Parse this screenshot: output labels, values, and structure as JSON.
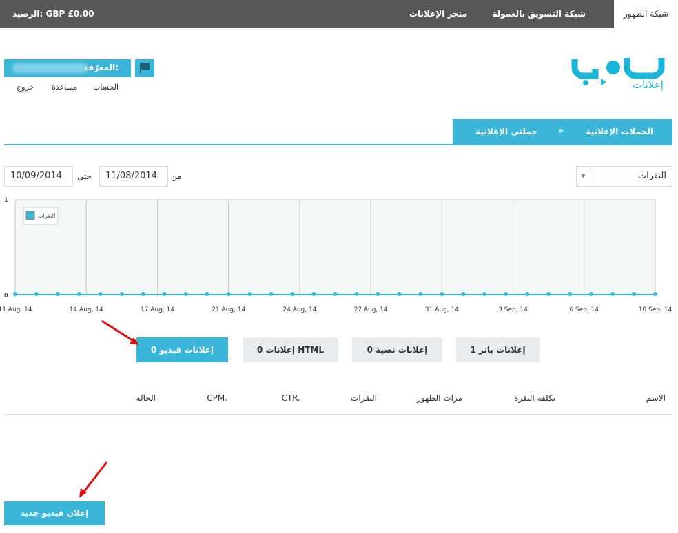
{
  "topbar": {
    "tabs": [
      "شبكة الظهور",
      "شبكة التسويق بالعمولة",
      "متجر الإعلانات"
    ],
    "balance": "الرصيد: GBP £0.00"
  },
  "logo": {
    "sub": "إعلانات"
  },
  "user": {
    "id_label": "المعرّف:",
    "links": [
      "الحساب",
      "مساعدة",
      "خروج"
    ]
  },
  "breadcrumb": {
    "items": [
      "الحملات الإعلانية",
      "حملتي الإعلانية"
    ],
    "sep": "»"
  },
  "filters": {
    "metric": "النقرات",
    "from_label": "من",
    "from": "11/08/2014",
    "to_label": "حتى",
    "to": "10/09/2014"
  },
  "chart_data": {
    "type": "line",
    "legend": "النقرات",
    "ylim": [
      0,
      1
    ],
    "yticks": [
      "0",
      "1"
    ],
    "xticks": [
      "11 Aug, 14",
      "14 Aug, 14",
      "17 Aug, 14",
      "21 Aug, 14",
      "24 Aug, 14",
      "27 Aug, 14",
      "31 Aug, 14",
      "3 Sep, 14",
      "6 Sep, 14",
      "10 Sep, 14"
    ],
    "series": [
      {
        "name": "النقرات",
        "values": [
          0,
          0,
          0,
          0,
          0,
          0,
          0,
          0,
          0,
          0,
          0,
          0,
          0,
          0,
          0,
          0,
          0,
          0,
          0,
          0,
          0,
          0,
          0,
          0,
          0,
          0,
          0,
          0,
          0,
          0,
          0
        ]
      }
    ],
    "color": "#3cb6d8"
  },
  "ad_tabs": [
    "1 إعلانات بانر",
    "0 إعلانات نصية",
    "0 إعلانات HTML",
    "0 إعلانات فيديو"
  ],
  "table": {
    "headers": [
      "الاسم",
      "تكلفة النقرة",
      "مرات الظهور",
      "النقرات",
      "CTR.",
      "CPM.",
      "الحالة"
    ]
  },
  "new_button": "إعلان فيديو جديد"
}
